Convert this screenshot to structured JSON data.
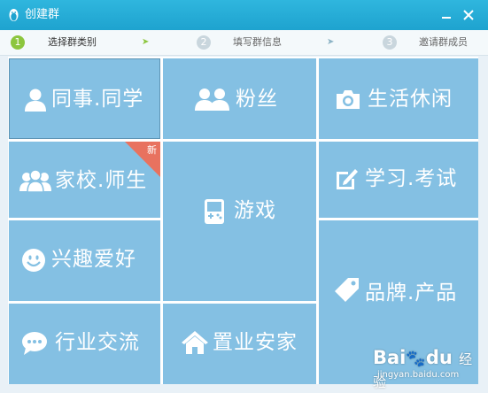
{
  "window": {
    "title": "创建群",
    "minimize_icon": "minimize-icon",
    "close_icon": "close-icon"
  },
  "steps": [
    {
      "num": "1",
      "label": "选择群类别",
      "active": true
    },
    {
      "num": "2",
      "label": "填写群信息",
      "active": false
    },
    {
      "num": "3",
      "label": "邀请群成员",
      "active": false
    }
  ],
  "categories": [
    {
      "label": "同事.同学",
      "icon": "person-icon"
    },
    {
      "label": "粉丝",
      "icon": "two-people-icon"
    },
    {
      "label": "生活休闲",
      "icon": "camera-icon"
    },
    {
      "label": "家校.师生",
      "icon": "group-icon",
      "badge": "新"
    },
    {
      "label": "游戏",
      "icon": "gamepad-icon"
    },
    {
      "label": "学习.考试",
      "icon": "edit-icon"
    },
    {
      "label": "兴趣爱好",
      "icon": "smiley-icon"
    },
    {
      "label": "品牌.产品",
      "icon": "tag-icon"
    },
    {
      "label": "行业交流",
      "icon": "chat-bubble-icon"
    },
    {
      "label": "置业安家",
      "icon": "house-icon"
    }
  ],
  "watermark": {
    "brand": "Bai",
    "brand2": "du",
    "suffix": "经验",
    "url": "jingyan.baidu.com"
  },
  "colors": {
    "titlebar": "#1ea3cf",
    "tile": "#84c0e3",
    "badge": "#e8725f",
    "step_active": "#8cc63e"
  }
}
